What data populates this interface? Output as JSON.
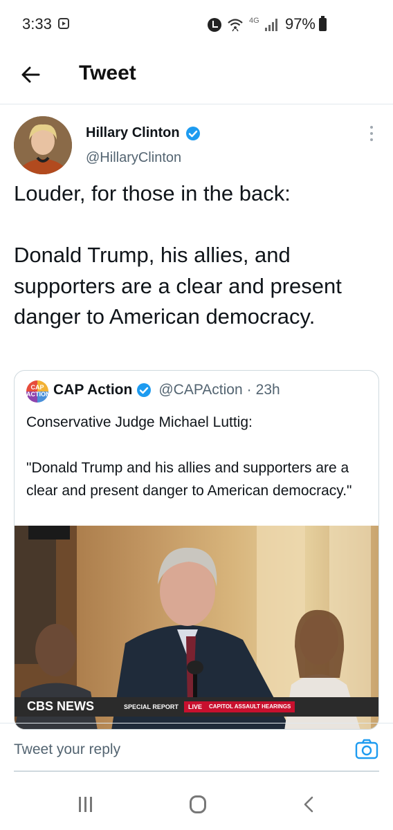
{
  "status_bar": {
    "time": "3:33",
    "network": "4G",
    "battery_text": "97%",
    "icons": [
      "message-icon",
      "alarm-icon",
      "wifi-icon",
      "signal-icon",
      "battery-icon"
    ]
  },
  "header": {
    "title": "Tweet",
    "back_icon": "arrow-left-icon"
  },
  "tweet": {
    "author_name": "Hillary Clinton",
    "author_handle": "@HillaryClinton",
    "verified": true,
    "text_line1": "Louder, for those in the back:",
    "text_line2": "Donald Trump, his allies, and supporters are a clear and present danger to American democracy."
  },
  "quote": {
    "avatar_text": "CAP ACTION",
    "author_name": "CAP Action",
    "author_handle": "@CAPAction",
    "separator": "·",
    "time": "23h",
    "verified": true,
    "text_line1": "Conservative Judge Michael Luttig:",
    "text_line2": "\"Donald Trump and his allies and supporters are a clear and present danger to American democracy.\"",
    "media": {
      "chyron_logo": "CBS NEWS",
      "chyron_special": "SPECIAL REPORT",
      "chyron_live": "LIVE",
      "chyron_topic": "CAPITOL ASSAULT HEARINGS"
    }
  },
  "reply": {
    "placeholder": "Tweet your reply",
    "camera_icon": "camera-icon"
  },
  "navbar": {
    "icons": [
      "recents-icon",
      "home-icon",
      "back-icon"
    ]
  },
  "colors": {
    "accent": "#1d9bf0",
    "text": "#0f1419",
    "secondary_text": "#536471",
    "border": "#cfd9de",
    "live_red": "#c8102e"
  }
}
